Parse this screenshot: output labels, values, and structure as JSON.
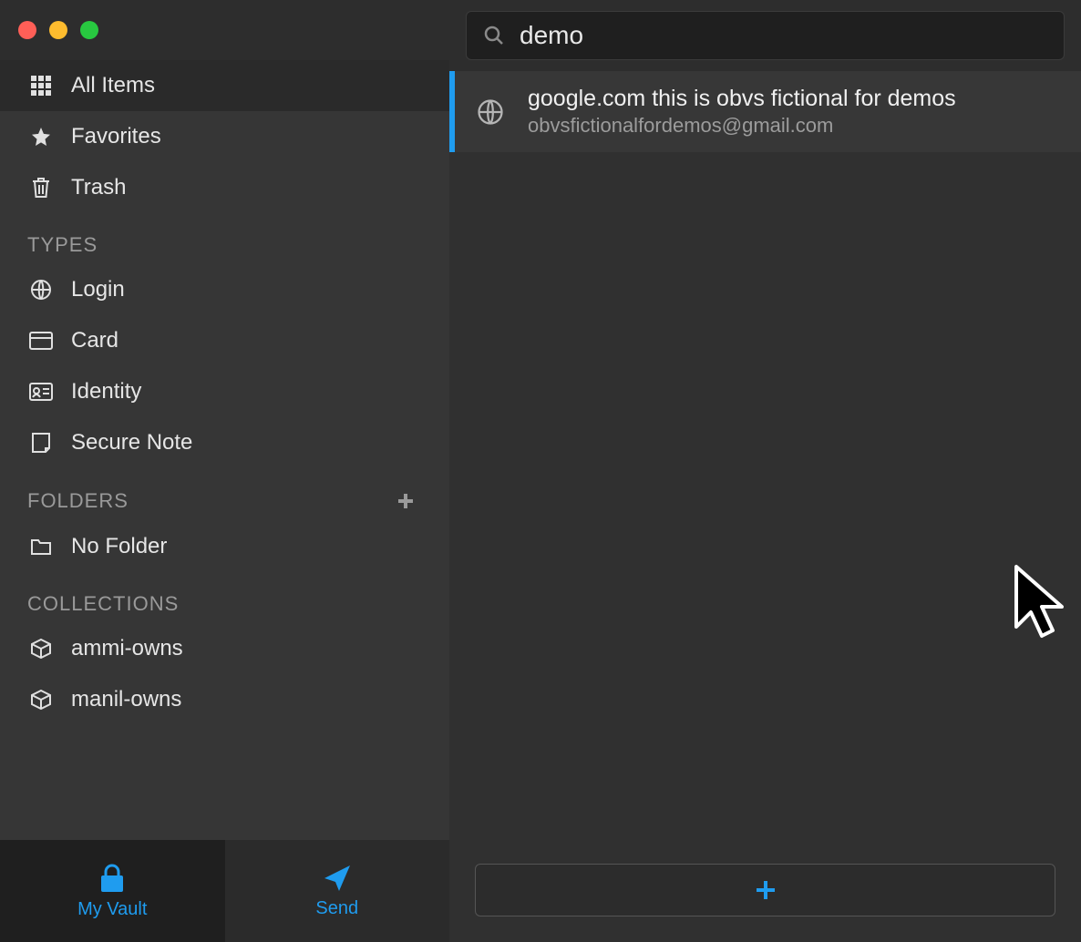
{
  "sidebar": {
    "items": [
      {
        "label": "All Items",
        "icon": "grid"
      },
      {
        "label": "Favorites",
        "icon": "star"
      },
      {
        "label": "Trash",
        "icon": "trash"
      }
    ],
    "types_header": "TYPES",
    "types": [
      {
        "label": "Login",
        "icon": "globe"
      },
      {
        "label": "Card",
        "icon": "card"
      },
      {
        "label": "Identity",
        "icon": "idcard"
      },
      {
        "label": "Secure Note",
        "icon": "note"
      }
    ],
    "folders_header": "FOLDERS",
    "folders": [
      {
        "label": "No Folder",
        "icon": "folder"
      }
    ],
    "collections_header": "COLLECTIONS",
    "collections": [
      {
        "label": "ammi-owns",
        "icon": "cube"
      },
      {
        "label": "manil-owns",
        "icon": "cube"
      }
    ],
    "tabs": {
      "vault": "My Vault",
      "send": "Send"
    }
  },
  "search": {
    "value": "demo"
  },
  "results": [
    {
      "title": "google.com this is obvs fictional for demos",
      "subtitle": "obvsfictionalfordemos@gmail.com"
    }
  ],
  "colors": {
    "accent": "#1f9cef"
  }
}
